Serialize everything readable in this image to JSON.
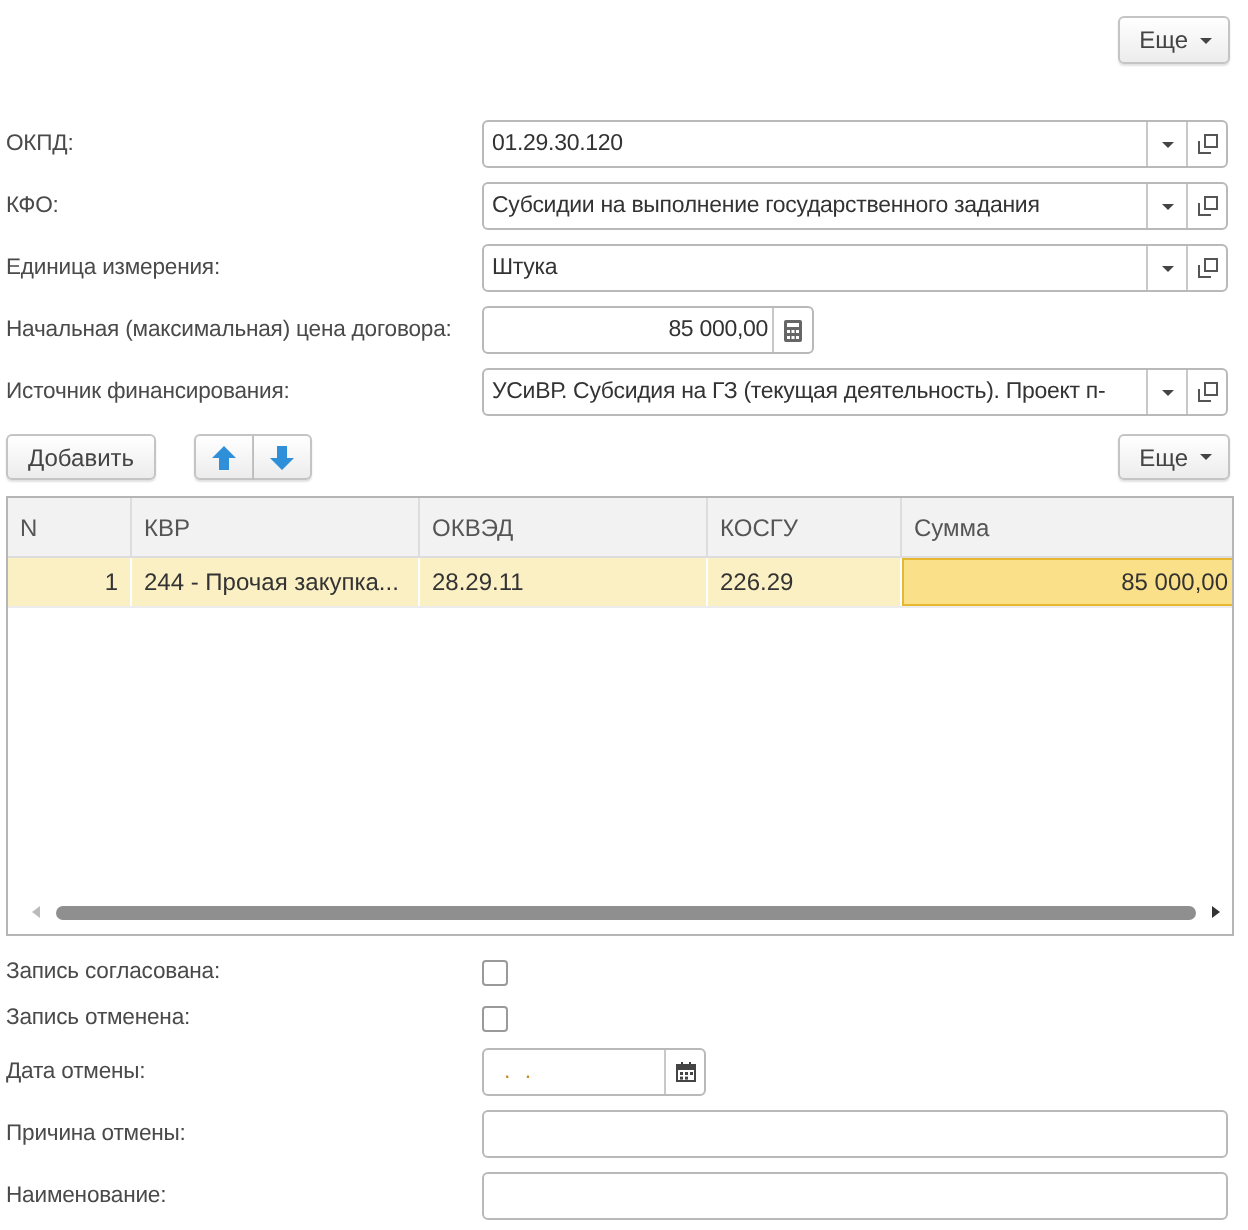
{
  "top_menu": {
    "label": "Еще"
  },
  "fields": [
    {
      "kind": "select",
      "label": "ОКПД:",
      "value": "01.29.30.120"
    },
    {
      "kind": "select",
      "label": "КФО:",
      "value": "Субсидии на выполнение государственного задания"
    },
    {
      "kind": "select",
      "label": "Единица измерения:",
      "value": "Штука"
    },
    {
      "kind": "number",
      "label": "Начальная (максимальная) цена договора:",
      "value": "85 000,00"
    },
    {
      "kind": "select",
      "label": "Источник финансирования:",
      "value": "УСиВР. Субсидия на ГЗ (текущая деятельность). Проект п-"
    }
  ],
  "toolbar": {
    "add": "Добавить",
    "more": "Еще"
  },
  "table": {
    "columns": [
      "N",
      "КВР",
      "ОКВЭД",
      "КОСГУ",
      "Сумма"
    ],
    "rows": [
      {
        "cells": [
          "1",
          "244 - Прочая закупка...",
          "28.29.11",
          "226.29",
          "85 000,00"
        ],
        "selected": true
      }
    ]
  },
  "bottom_fields": [
    {
      "kind": "checkbox",
      "label": "Запись согласована:",
      "checked": false
    },
    {
      "kind": "checkbox",
      "label": "Запись отменена:",
      "checked": false
    },
    {
      "kind": "date",
      "label": "Дата отмены:",
      "value": ".  ."
    },
    {
      "kind": "text",
      "label": "Причина отмены:"
    },
    {
      "kind": "text",
      "label": "Наименование:"
    }
  ]
}
